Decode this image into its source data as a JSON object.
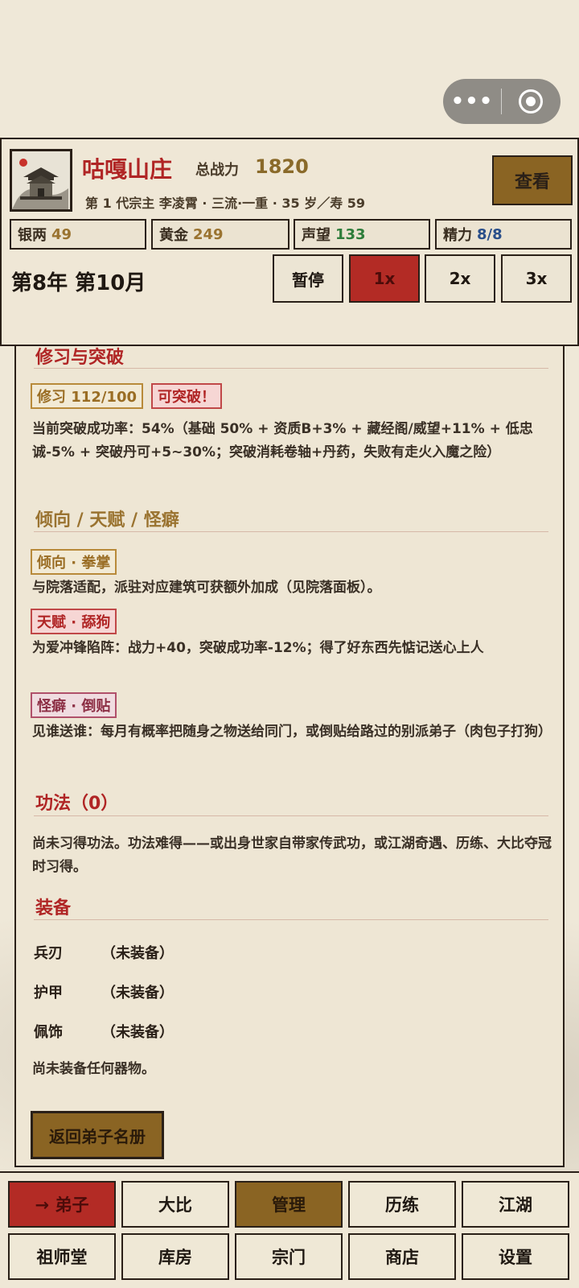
{
  "header": {
    "sect_name": "咕嘎山庄",
    "power_label": "总战力",
    "power_value": "1820",
    "leader_line": "第 1 代宗主 李凌霄 · 三流·一重 · 35 岁／寿 59",
    "view_button": "查看",
    "resources": [
      {
        "label": "银两",
        "value": "49",
        "color": "#9a7330"
      },
      {
        "label": "黄金",
        "value": "249",
        "color": "#9a7330"
      },
      {
        "label": "声望",
        "value": "133",
        "color": "#2e7d3a"
      },
      {
        "label": "精力",
        "value": "8/8",
        "color": "#2a4f8a"
      }
    ],
    "date": "第8年 第10月",
    "controls": [
      "暂停",
      "1x",
      "2x",
      "3x"
    ],
    "active_control": "1x"
  },
  "cultivation": {
    "title": "修习与突破",
    "progress_tag": "修习 112/100",
    "breakthrough_tag": "可突破！",
    "description": "当前突破成功率：54%（基础 50% + 资质B+3% + 藏经阁/威望+11% + 低忠诚-5% + 突破丹可+5~30%；突破消耗卷轴+丹药，失败有走火入魔之险）"
  },
  "traits": {
    "title": "倾向 / 天赋 / 怪癖",
    "items": [
      {
        "tag": "倾向 · 拳掌",
        "style": "gold",
        "text": "与院落适配，派驻对应建筑可获额外加成（见院落面板）。"
      },
      {
        "tag": "天赋 · 舔狗",
        "style": "red",
        "text": "为爱冲锋陷阵：战力+40，突破成功率-12%；得了好东西先惦记送心上人"
      },
      {
        "tag": "怪癖 · 倒贴",
        "style": "pink",
        "text": "见谁送谁：每月有概率把随身之物送给同门，或倒贴给路过的别派弟子（肉包子打狗）"
      }
    ]
  },
  "skills": {
    "title": "功法（0）",
    "text": "尚未习得功法。功法难得——或出身世家自带家传武功，或江湖奇遇、历练、大比夺冠时习得。"
  },
  "equipment": {
    "title": "装备",
    "slots": [
      {
        "slot": "兵刃",
        "value": "（未装备）"
      },
      {
        "slot": "护甲",
        "value": "（未装备）"
      },
      {
        "slot": "佩饰",
        "value": "（未装备）"
      }
    ],
    "note": "尚未装备任何器物。"
  },
  "back_button": "返回弟子名册",
  "nav": {
    "row1": [
      "→ 弟子",
      "大比",
      "管理",
      "历练",
      "江湖"
    ],
    "row2": [
      "祖师堂",
      "库房",
      "宗门",
      "商店",
      "设置"
    ]
  },
  "colors": {
    "accent_red": "#b32b25",
    "accent_gold": "#8a6423",
    "ink": "#2a2018",
    "paper": "#efe7d6"
  }
}
